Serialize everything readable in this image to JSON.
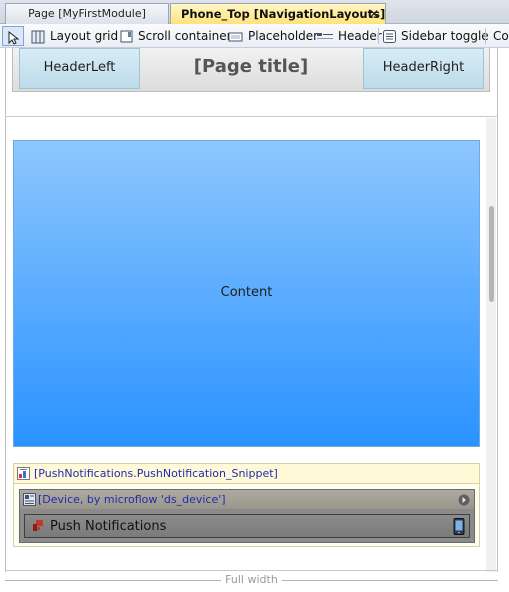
{
  "tabs": [
    {
      "label": "Page [MyFirstModule]",
      "active": false
    },
    {
      "label": "Phone_Top [NavigationLayouts]",
      "active": true,
      "close_glyph": "✕"
    }
  ],
  "toolbar": {
    "pointer_icon": "pointer-icon",
    "items": [
      {
        "label": "Layout grid",
        "icon": "layout-grid-icon"
      },
      {
        "label": "Scroll container",
        "icon": "scroll-container-icon"
      },
      {
        "label": "Placeholder",
        "icon": "placeholder-icon"
      },
      {
        "label": "Header",
        "icon": "header-icon"
      },
      {
        "label": "Sidebar toggle",
        "icon": "sidebar-toggle-icon"
      },
      {
        "label": "Co",
        "icon": ""
      }
    ]
  },
  "header": {
    "left_label": "HeaderLeft",
    "title": "[Page title]",
    "right_label": "HeaderRight"
  },
  "content": {
    "label": "Content"
  },
  "snippet": {
    "title": "[PushNotifications.PushNotification_Snippet]",
    "dataview_title": "[Device, by microflow 'ds_device']",
    "button_label": "Push Notifications"
  },
  "ruler": {
    "label": "Full width"
  },
  "colors": {
    "active_tab": "#ffe27a",
    "content_top": "#8ec7ff",
    "content_bottom": "#2992ff",
    "link_text": "#1e2cb3"
  }
}
